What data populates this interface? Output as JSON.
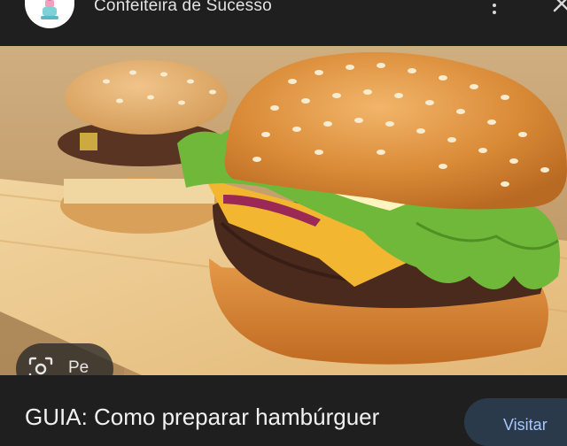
{
  "header": {
    "site_name": "Confeiteira de Sucesso",
    "logo_icon": "chef-mixer-logo-icon",
    "menu_icon": "more-vert-icon",
    "close_icon": "close-icon"
  },
  "image": {
    "subject": "hamburger",
    "lens_label": "Pe"
  },
  "footer": {
    "headline": "GUIA: Como preparar hambúrguer",
    "visit_label": "Visitar"
  },
  "colors": {
    "background": "#1f1f1f",
    "accent": "#a8c7fa",
    "visit_button": "#2b3a4a"
  }
}
